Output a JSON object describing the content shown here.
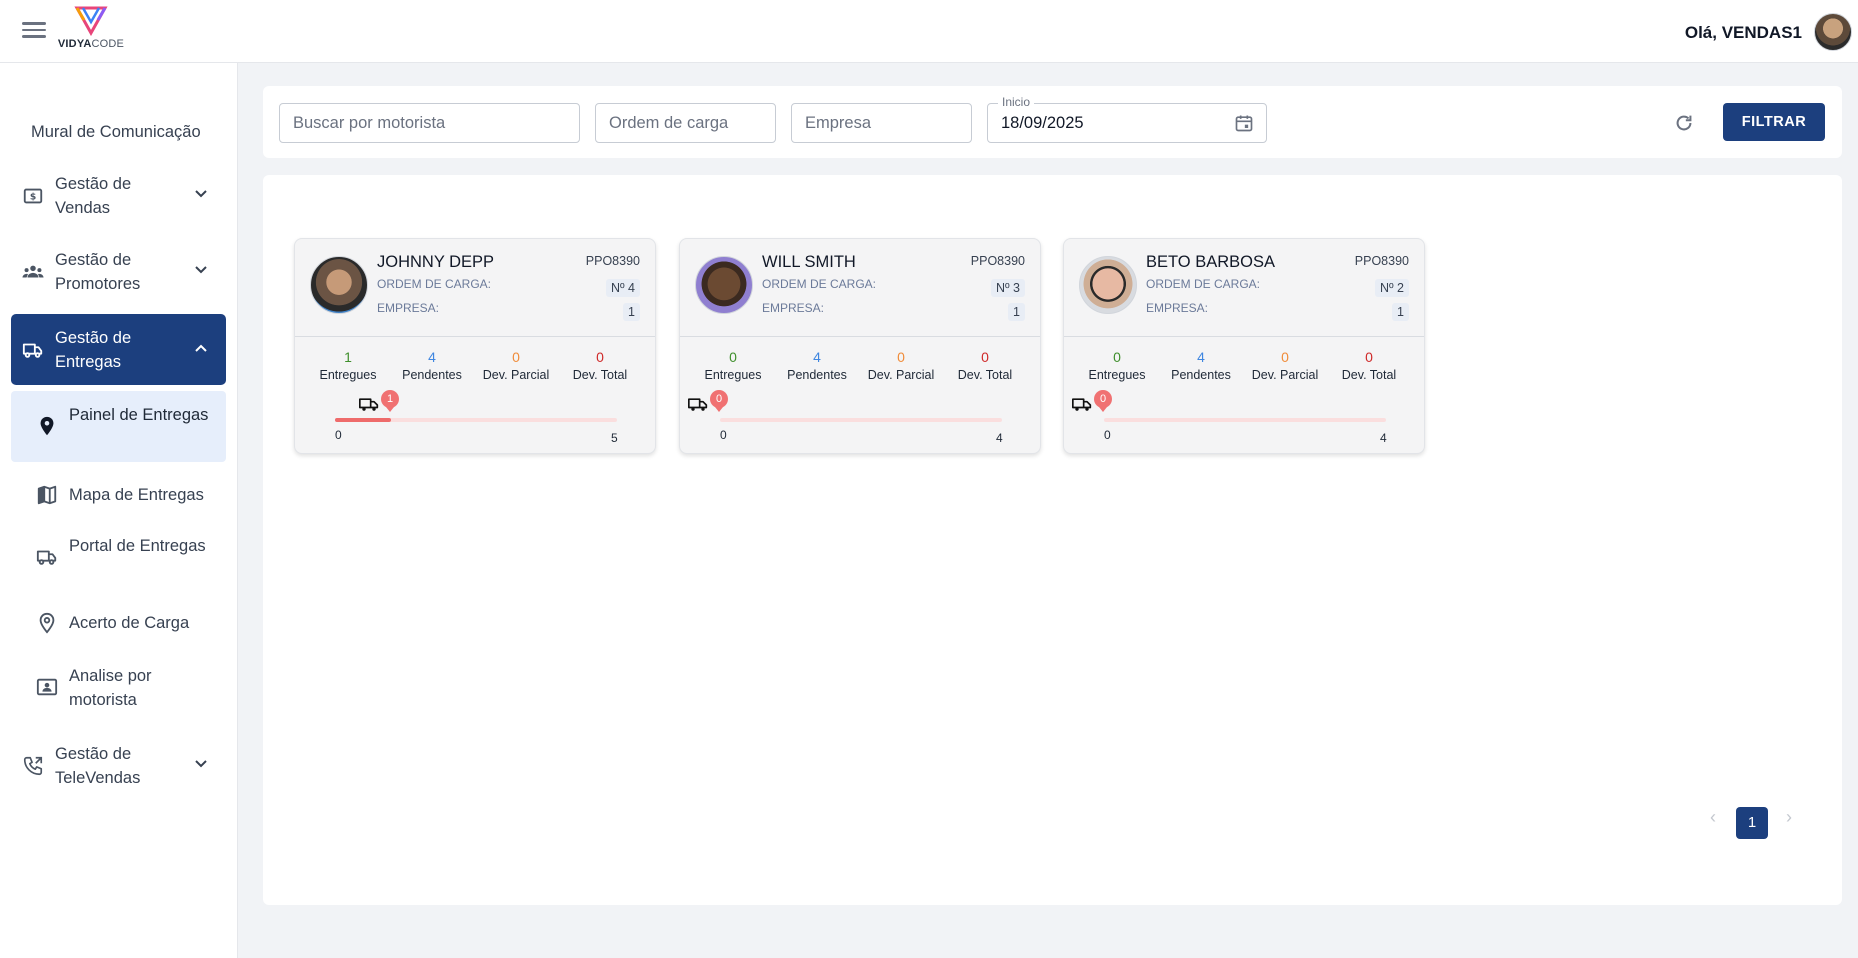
{
  "header": {
    "logo_brand_bold": "VIDYA",
    "logo_brand_light": "CODE",
    "greeting": "Olá, VENDAS1"
  },
  "sidebar": {
    "mural": "Mural de Comunicação",
    "groups": [
      {
        "label": "Gestão de Vendas",
        "icon": "dollar-icon",
        "expanded": false
      },
      {
        "label": "Gestão de Promotores",
        "icon": "group-icon",
        "expanded": false
      },
      {
        "label": "Gestão de Entregas",
        "icon": "truck-icon",
        "expanded": true,
        "active": true
      },
      {
        "label": "Gestão de TeleVendas",
        "icon": "phone-forward-icon",
        "expanded": false
      }
    ],
    "subitems": [
      {
        "label": "Painel de Entregas",
        "icon": "location-pin-icon",
        "active": true
      },
      {
        "label": "Mapa de Entregas",
        "icon": "map-icon"
      },
      {
        "label": "Portal de Entregas",
        "icon": "truck-icon"
      },
      {
        "label": "Acerto de Carga",
        "icon": "location-outline-icon"
      },
      {
        "label": "Analise por motorista",
        "icon": "person-card-icon"
      }
    ]
  },
  "filters": {
    "driver_placeholder": "Buscar por motorista",
    "order_placeholder": "Ordem de carga",
    "company_placeholder": "Empresa",
    "start_label": "Inicio",
    "start_value": "18/09/2025",
    "filter_button": "FILTRAR"
  },
  "labels": {
    "order": "ORDEM DE CARGA:",
    "company": "EMPRESA:",
    "delivered": "Entregues",
    "pending": "Pendentes",
    "partial": "Dev. Parcial",
    "total": "Dev. Total"
  },
  "cards": [
    {
      "name": "JOHNNY DEPP",
      "plate": "PPO8390",
      "order": "Nº 4",
      "company": "1",
      "delivered": "1",
      "pending": "4",
      "partial": "0",
      "total": "0",
      "progress_value": "1",
      "range_min": "0",
      "range_max": "5",
      "progress_fraction": 0.2
    },
    {
      "name": "WILL SMITH",
      "plate": "PPO8390",
      "order": "Nº 3",
      "company": "1",
      "delivered": "0",
      "pending": "4",
      "partial": "0",
      "total": "0",
      "progress_value": "0",
      "range_min": "0",
      "range_max": "4",
      "progress_fraction": 0
    },
    {
      "name": "BETO BARBOSA",
      "plate": "PPO8390",
      "order": "Nº 2",
      "company": "1",
      "delivered": "0",
      "pending": "4",
      "partial": "0",
      "total": "0",
      "progress_value": "0",
      "range_min": "0",
      "range_max": "4",
      "progress_fraction": 0
    }
  ],
  "pagination": {
    "current": "1",
    "prev": "‹",
    "next": "›"
  },
  "colors": {
    "primary": "#1c3f7e",
    "delivered": "#3f8f2c",
    "pending": "#3f86e0",
    "partial": "#f08c3a",
    "total": "#cf2a2a",
    "progress": "#ee6b6b"
  }
}
